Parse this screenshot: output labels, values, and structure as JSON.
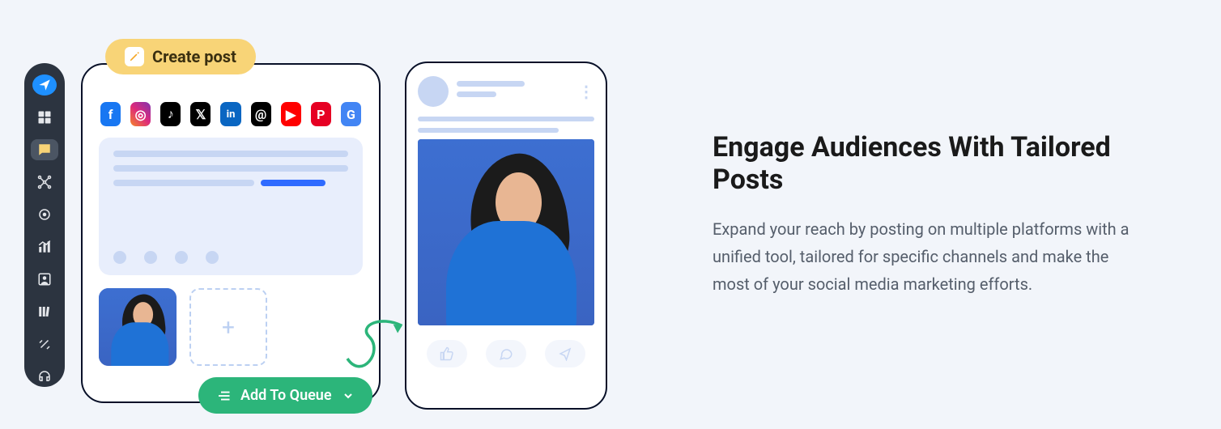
{
  "createPost": {
    "label": "Create post"
  },
  "queue": {
    "label": "Add To Queue"
  },
  "channels": [
    {
      "name": "facebook",
      "bg": "#1877f2",
      "glyph": "f"
    },
    {
      "name": "instagram",
      "bg": "linear-gradient(45deg,#f58529,#dd2a7b,#8134af)",
      "glyph": "◎"
    },
    {
      "name": "tiktok",
      "bg": "#000",
      "glyph": "♪"
    },
    {
      "name": "x",
      "bg": "#000",
      "glyph": "𝕏"
    },
    {
      "name": "linkedin",
      "bg": "#0a66c2",
      "glyph": "in"
    },
    {
      "name": "threads",
      "bg": "#000",
      "glyph": "@"
    },
    {
      "name": "youtube",
      "bg": "#ff0000",
      "glyph": "▶"
    },
    {
      "name": "pinterest",
      "bg": "#e60023",
      "glyph": "P"
    },
    {
      "name": "google",
      "bg": "#4285f4",
      "glyph": "G"
    }
  ],
  "sidebar": {
    "icons": [
      "dashboard",
      "posts",
      "connections",
      "location",
      "analytics",
      "profile",
      "library",
      "tools",
      "support"
    ]
  },
  "copy": {
    "heading": "Engage Audiences With Tailored Posts",
    "body": "Expand your reach by posting on multiple platforms with a unified tool, tailored for specific channels and make the most of your social media marketing efforts."
  }
}
